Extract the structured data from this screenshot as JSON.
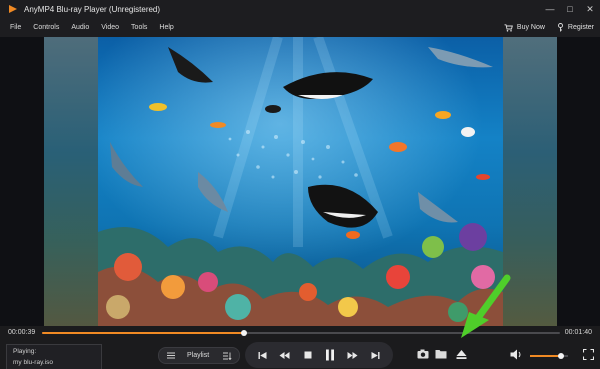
{
  "window": {
    "title": "AnyMP4 Blu-ray Player (Unregistered)",
    "controls": [
      "minimize-icon",
      "maximize-icon",
      "close-icon"
    ]
  },
  "menu": {
    "items": [
      "File",
      "Controls",
      "Audio",
      "Video",
      "Tools",
      "Help"
    ],
    "buy_now": "Buy Now",
    "register": "Register"
  },
  "timeline": {
    "current": "00:00:39",
    "total": "00:01:40",
    "progress_percent": 39
  },
  "playing": {
    "label": "Playing:",
    "file": "my blu-ray.iso"
  },
  "playlist": {
    "label": "Playlist"
  },
  "transport": {
    "buttons": [
      "skip-previous-icon",
      "rewind-icon",
      "stop-icon",
      "pause-icon",
      "fast-forward-icon",
      "skip-next-icon"
    ]
  },
  "right_controls": [
    "snapshot-icon",
    "open-folder-icon",
    "eject-icon",
    "volume-icon",
    "fullscreen-icon"
  ],
  "volume": {
    "level_percent": 82
  },
  "colors": {
    "accent": "#f08a24",
    "annotation_arrow": "#4fce2a",
    "background": "#1b1b1d"
  }
}
